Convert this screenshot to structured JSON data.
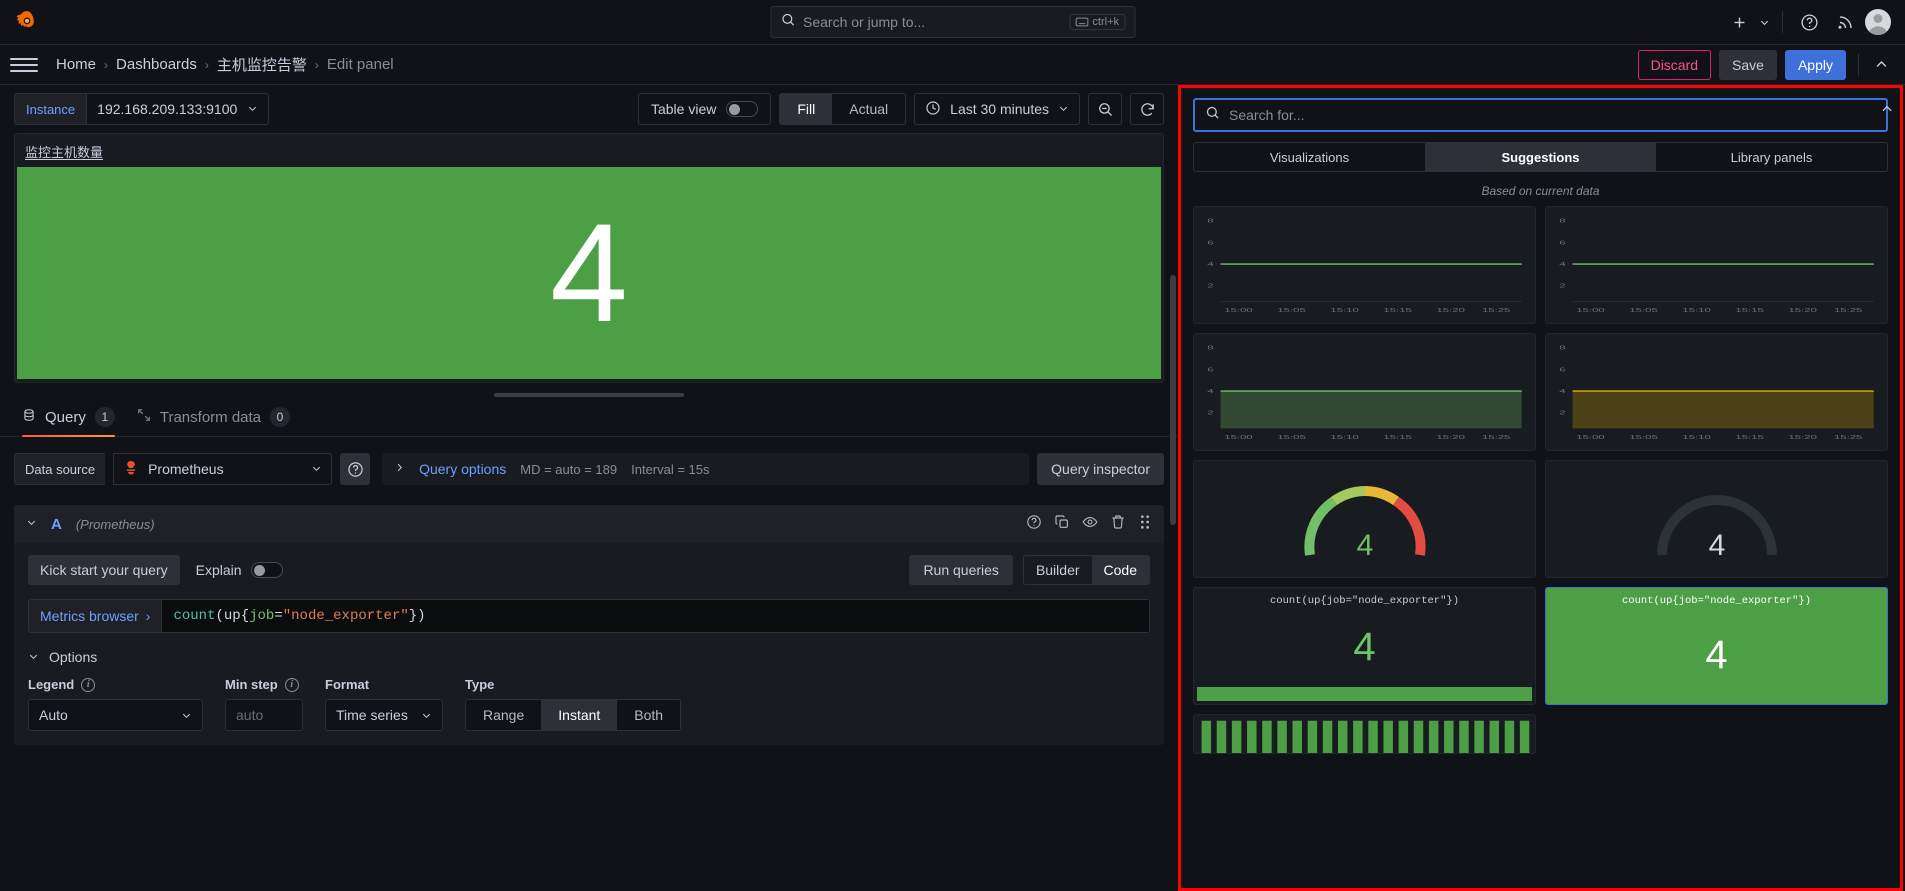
{
  "topnav": {
    "logo_icon": "grafana-logo-icon",
    "search_placeholder": "Search or jump to...",
    "search_icon": "search-icon",
    "kbd_icon": "keyboard-icon",
    "kbd_label": "ctrl+k",
    "plus_icon": "plus-icon",
    "chevron_icon": "chevron-down-icon",
    "help_icon": "help-circle-icon",
    "news_icon": "rss-icon",
    "avatar_icon": "user-avatar-icon"
  },
  "breadcrumb": {
    "menu_icon": "hamburger-menu-icon",
    "items": [
      {
        "label": "Home"
      },
      {
        "label": "Dashboards"
      },
      {
        "label": "主机监控告警"
      },
      {
        "label": "Edit panel"
      }
    ],
    "separator": "›",
    "discard_label": "Discard",
    "save_label": "Save",
    "apply_label": "Apply",
    "collapse_icon": "chevron-up-icon",
    "accent_discard": "#e0226e",
    "accent_apply": "#3d71d9"
  },
  "toolbar": {
    "instance_label": "Instance",
    "instance_value": "192.168.209.133:9100",
    "instance_chevron": "chevron-down-icon",
    "table_view_label": "Table view",
    "table_view_on": false,
    "fill_label": "Fill",
    "actual_label": "Actual",
    "fill_active": true,
    "time_icon": "clock-icon",
    "time_range": "Last 30 minutes",
    "time_chevron": "chevron-down-icon",
    "zoom_out_icon": "zoom-out-icon",
    "refresh_icon": "refresh-icon"
  },
  "panel": {
    "title": "监控主机数量",
    "value": "4",
    "bg_color": "#4d9f46",
    "text_color": "#ffffff"
  },
  "tabs": [
    {
      "label": "Query",
      "badge": "1",
      "icon": "database-icon",
      "active": true
    },
    {
      "label": "Transform data",
      "badge": "0",
      "icon": "transform-icon",
      "active": false
    }
  ],
  "datasource": {
    "label": "Data source",
    "name": "Prometheus",
    "icon": "prometheus-icon",
    "chevron": "chevron-down-icon",
    "help_icon": "help-circle-icon",
    "query_options_label": "Query options",
    "query_options_chevron": "chevron-right-icon",
    "md_text": "MD = auto = 189",
    "interval_text": "Interval = 15s",
    "query_inspector_label": "Query inspector"
  },
  "query": {
    "collapse_icon": "chevron-down-icon",
    "ref_id": "A",
    "datasource_note": "(Prometheus)",
    "actions": [
      {
        "icon": "help-circle-icon",
        "name": "query-help-icon"
      },
      {
        "icon": "copy-icon",
        "name": "duplicate-query-icon"
      },
      {
        "icon": "eye-icon",
        "name": "toggle-visibility-icon"
      },
      {
        "icon": "trash-icon",
        "name": "remove-query-icon"
      },
      {
        "icon": "drag-handle-icon",
        "name": "drag-query-icon"
      }
    ],
    "kick_start_label": "Kick start your query",
    "explain_label": "Explain",
    "explain_on": false,
    "run_queries_label": "Run queries",
    "builder_label": "Builder",
    "code_label": "Code",
    "mode_active": "Code",
    "metrics_browser_label": "Metrics browser",
    "metrics_browser_chevron": "›",
    "expression": "count(up{job=\"node_exporter\"})",
    "expr_tokens": {
      "fn": "count",
      "open": "(",
      "metric": "up",
      "brace_open": "{",
      "label": "job",
      "equals": "=",
      "value": "\"node_exporter\"",
      "brace_close": "}",
      "close": ")"
    },
    "options_label": "Options",
    "options_chevron": "chevron-down-icon",
    "fields": {
      "legend_label": "Legend",
      "legend_value": "Auto",
      "min_step_label": "Min step",
      "min_step_placeholder": "auto",
      "format_label": "Format",
      "format_value": "Time series",
      "type_label": "Type",
      "type_options": [
        "Range",
        "Instant",
        "Both"
      ],
      "type_active": "Instant"
    }
  },
  "sidebar": {
    "search_placeholder": "Search for...",
    "search_icon": "search-icon",
    "collapse_icon": "chevron-up-icon",
    "tabs": [
      {
        "label": "Visualizations",
        "active": false
      },
      {
        "label": "Suggestions",
        "active": true
      },
      {
        "label": "Library panels",
        "active": false
      }
    ],
    "based_on_label": "Based on current data",
    "highlight_border": "#ff0000",
    "focus_border": "#3d71d9",
    "suggestions": [
      {
        "name": "timeseries-line-1",
        "type": "line",
        "color": "#73bf69",
        "selected": false
      },
      {
        "name": "timeseries-line-2",
        "type": "line",
        "color": "#73bf69",
        "selected": false
      },
      {
        "name": "timeseries-area-green",
        "type": "area",
        "color": "#73bf69",
        "selected": false
      },
      {
        "name": "timeseries-area-yellow",
        "type": "area",
        "color": "#e0b400",
        "selected": false
      },
      {
        "name": "gauge-colored",
        "type": "gauge",
        "value": "4",
        "selected": false
      },
      {
        "name": "gauge-plain",
        "type": "gauge",
        "value": "4",
        "selected": false
      },
      {
        "name": "stat-with-sparkline",
        "type": "stat",
        "title": "count(up{job=\"node_exporter\"})",
        "value": "4",
        "selected": false
      },
      {
        "name": "stat-green-background",
        "type": "stat-bg",
        "title": "count(up{job=\"node_exporter\"})",
        "value": "4",
        "selected": true
      },
      {
        "name": "bar-chart-green",
        "type": "bars",
        "selected": false
      }
    ]
  },
  "chart_data": {
    "type": "line",
    "title": "监控主机数量",
    "x": [
      "15:00",
      "15:05",
      "15:10",
      "15:15",
      "15:20",
      "15:25"
    ],
    "series": [
      {
        "name": "count(up{job=\"node_exporter\"})",
        "values": [
          4,
          4,
          4,
          4,
          4,
          4
        ]
      }
    ],
    "ylim": [
      0,
      8
    ],
    "yticks": [
      0,
      2,
      4,
      6,
      8
    ],
    "xlabel": "",
    "ylabel": "",
    "grid": true,
    "legend": "none",
    "current_value": 4
  }
}
